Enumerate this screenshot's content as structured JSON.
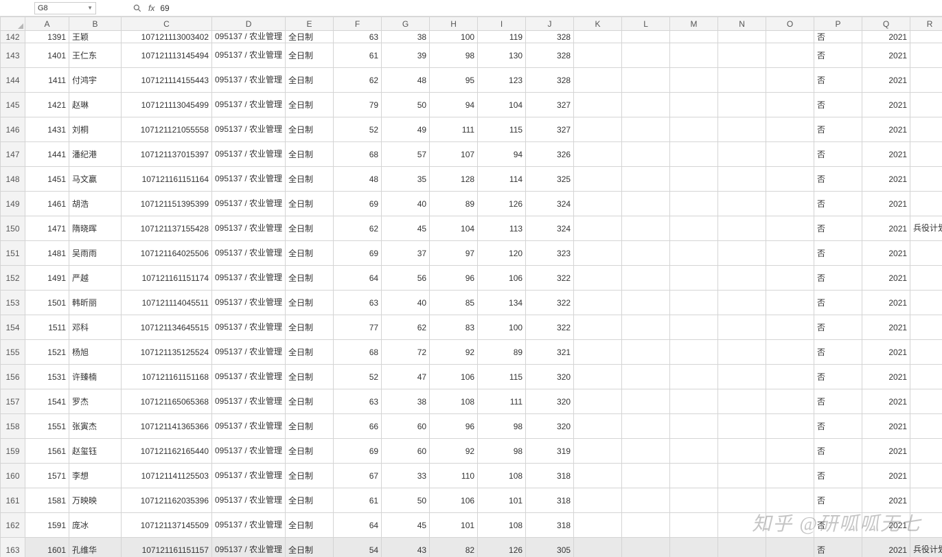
{
  "nameBox": "G8",
  "formulaValue": "69",
  "columns": [
    "A",
    "B",
    "C",
    "D",
    "E",
    "F",
    "G",
    "H",
    "I",
    "J",
    "K",
    "L",
    "M",
    "N",
    "O",
    "P",
    "Q",
    "R"
  ],
  "selectedCol": "G",
  "watermark": "知乎 @研呱呱无七",
  "majorCell": "095137 / 农业管理",
  "rows": [
    {
      "r": 142,
      "A": "1391",
      "B": "王颖",
      "C": "107121113003402",
      "D": "@major",
      "E": "全日制",
      "F": "63",
      "G": "38",
      "H": "100",
      "I": "119",
      "J": "328",
      "P": "否",
      "Q": "2021",
      "R": ""
    },
    {
      "r": 143,
      "A": "1401",
      "B": "王仁东",
      "C": "107121113145494",
      "D": "@major",
      "E": "全日制",
      "F": "61",
      "G": "39",
      "H": "98",
      "I": "130",
      "J": "328",
      "P": "否",
      "Q": "2021",
      "R": ""
    },
    {
      "r": 144,
      "A": "1411",
      "B": "付鸿宇",
      "C": "107121114155443",
      "D": "@major",
      "E": "全日制",
      "F": "62",
      "G": "48",
      "H": "95",
      "I": "123",
      "J": "328",
      "P": "否",
      "Q": "2021",
      "R": ""
    },
    {
      "r": 145,
      "A": "1421",
      "B": "赵琳",
      "C": "107121113045499",
      "D": "@major",
      "E": "全日制",
      "F": "79",
      "G": "50",
      "H": "94",
      "I": "104",
      "J": "327",
      "P": "否",
      "Q": "2021",
      "R": ""
    },
    {
      "r": 146,
      "A": "1431",
      "B": "刘桐",
      "C": "107121121055558",
      "D": "@major",
      "E": "全日制",
      "F": "52",
      "G": "49",
      "H": "111",
      "I": "115",
      "J": "327",
      "P": "否",
      "Q": "2021",
      "R": ""
    },
    {
      "r": 147,
      "A": "1441",
      "B": "潘纪港",
      "C": "107121137015397",
      "D": "@major",
      "E": "全日制",
      "F": "68",
      "G": "57",
      "H": "107",
      "I": "94",
      "J": "326",
      "P": "否",
      "Q": "2021",
      "R": ""
    },
    {
      "r": 148,
      "A": "1451",
      "B": "马文赢",
      "C": "107121161151164",
      "D": "@major",
      "E": "全日制",
      "F": "48",
      "G": "35",
      "H": "128",
      "I": "114",
      "J": "325",
      "P": "否",
      "Q": "2021",
      "R": ""
    },
    {
      "r": 149,
      "A": "1461",
      "B": "胡浩",
      "C": "107121151395399",
      "D": "@major",
      "E": "全日制",
      "F": "69",
      "G": "40",
      "H": "89",
      "I": "126",
      "J": "324",
      "P": "否",
      "Q": "2021",
      "R": ""
    },
    {
      "r": 150,
      "A": "1471",
      "B": "隋晓晖",
      "C": "107121137155428",
      "D": "@major",
      "E": "全日制",
      "F": "62",
      "G": "45",
      "H": "104",
      "I": "113",
      "J": "324",
      "P": "否",
      "Q": "2021",
      "R": "兵役计划"
    },
    {
      "r": 151,
      "A": "1481",
      "B": "吴雨雨",
      "C": "107121164025506",
      "D": "@major",
      "E": "全日制",
      "F": "69",
      "G": "37",
      "H": "97",
      "I": "120",
      "J": "323",
      "P": "否",
      "Q": "2021",
      "R": ""
    },
    {
      "r": 152,
      "A": "1491",
      "B": "严越",
      "C": "107121161151174",
      "D": "@major",
      "E": "全日制",
      "F": "64",
      "G": "56",
      "H": "96",
      "I": "106",
      "J": "322",
      "P": "否",
      "Q": "2021",
      "R": ""
    },
    {
      "r": 153,
      "A": "1501",
      "B": "韩昕丽",
      "C": "107121114045511",
      "D": "@major",
      "E": "全日制",
      "F": "63",
      "G": "40",
      "H": "85",
      "I": "134",
      "J": "322",
      "P": "否",
      "Q": "2021",
      "R": ""
    },
    {
      "r": 154,
      "A": "1511",
      "B": "邓科",
      "C": "107121134645515",
      "D": "@major",
      "E": "全日制",
      "F": "77",
      "G": "62",
      "H": "83",
      "I": "100",
      "J": "322",
      "P": "否",
      "Q": "2021",
      "R": ""
    },
    {
      "r": 155,
      "A": "1521",
      "B": "杨旭",
      "C": "107121135125524",
      "D": "@major",
      "E": "全日制",
      "F": "68",
      "G": "72",
      "H": "92",
      "I": "89",
      "J": "321",
      "P": "否",
      "Q": "2021",
      "R": ""
    },
    {
      "r": 156,
      "A": "1531",
      "B": "许臻楠",
      "C": "107121161151168",
      "D": "@major",
      "E": "全日制",
      "F": "52",
      "G": "47",
      "H": "106",
      "I": "115",
      "J": "320",
      "P": "否",
      "Q": "2021",
      "R": ""
    },
    {
      "r": 157,
      "A": "1541",
      "B": "罗杰",
      "C": "107121165065368",
      "D": "@major",
      "E": "全日制",
      "F": "63",
      "G": "38",
      "H": "108",
      "I": "111",
      "J": "320",
      "P": "否",
      "Q": "2021",
      "R": ""
    },
    {
      "r": 158,
      "A": "1551",
      "B": "张寅杰",
      "C": "107121141365366",
      "D": "@major",
      "E": "全日制",
      "F": "66",
      "G": "60",
      "H": "96",
      "I": "98",
      "J": "320",
      "P": "否",
      "Q": "2021",
      "R": ""
    },
    {
      "r": 159,
      "A": "1561",
      "B": "赵玺钰",
      "C": "107121162165440",
      "D": "@major",
      "E": "全日制",
      "F": "69",
      "G": "60",
      "H": "92",
      "I": "98",
      "J": "319",
      "P": "否",
      "Q": "2021",
      "R": ""
    },
    {
      "r": 160,
      "A": "1571",
      "B": "李想",
      "C": "107121141125503",
      "D": "@major",
      "E": "全日制",
      "F": "67",
      "G": "33",
      "H": "110",
      "I": "108",
      "J": "318",
      "P": "否",
      "Q": "2021",
      "R": ""
    },
    {
      "r": 161,
      "A": "1581",
      "B": "万映映",
      "C": "107121162035396",
      "D": "@major",
      "E": "全日制",
      "F": "61",
      "G": "50",
      "H": "106",
      "I": "101",
      "J": "318",
      "P": "否",
      "Q": "2021",
      "R": ""
    },
    {
      "r": 162,
      "A": "1591",
      "B": "庞冰",
      "C": "107121137145509",
      "D": "@major",
      "E": "全日制",
      "F": "64",
      "G": "45",
      "H": "101",
      "I": "108",
      "J": "318",
      "P": "否",
      "Q": "2021",
      "R": ""
    },
    {
      "r": 163,
      "A": "1601",
      "B": "孔维华",
      "C": "107121161151157",
      "D": "@major",
      "E": "全日制",
      "F": "54",
      "G": "43",
      "H": "82",
      "I": "126",
      "J": "305",
      "P": "否",
      "Q": "2021",
      "R": "兵役计划"
    }
  ]
}
